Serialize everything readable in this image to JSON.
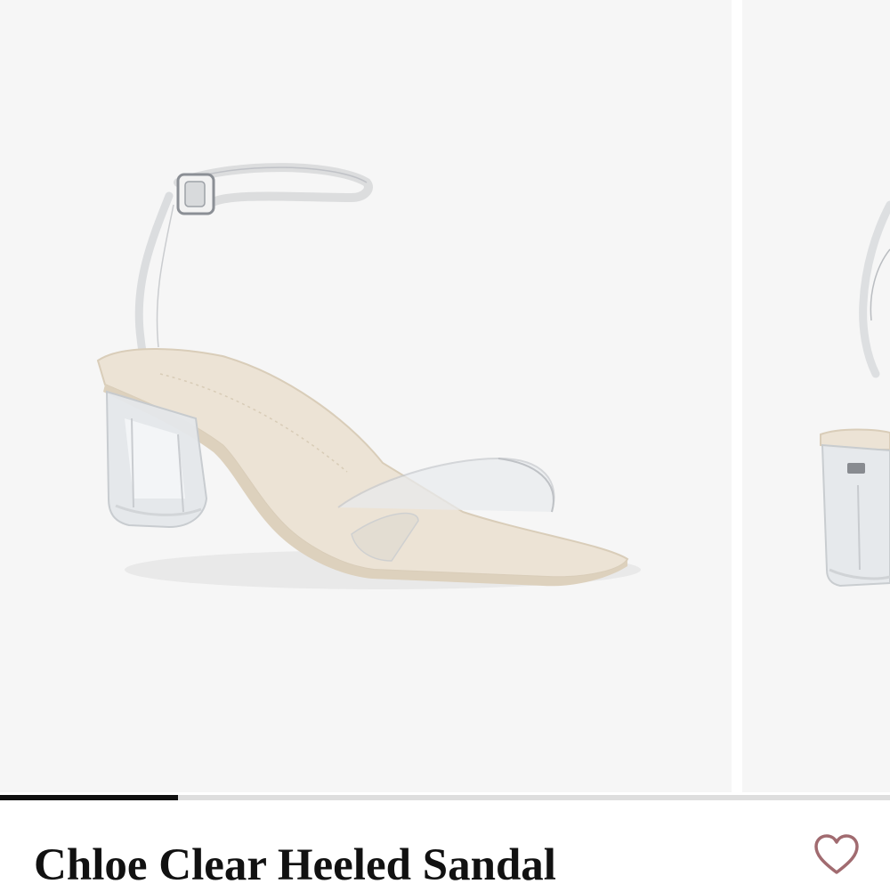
{
  "gallery": {
    "slides": [
      {
        "alt": "clear heeled sandal, three-quarter view"
      },
      {
        "alt": "clear heeled sandal, side view"
      }
    ],
    "progress_fraction": 0.2,
    "colors": {
      "background": "#f6f6f6",
      "insole": "#ece3d5",
      "indicator": "#111111",
      "track": "#dedede"
    }
  },
  "product": {
    "title": "Chloe Clear Heeled Sandal",
    "wishlist_icon": "heart-outline-icon",
    "wishlist_color": "#a16b70"
  }
}
